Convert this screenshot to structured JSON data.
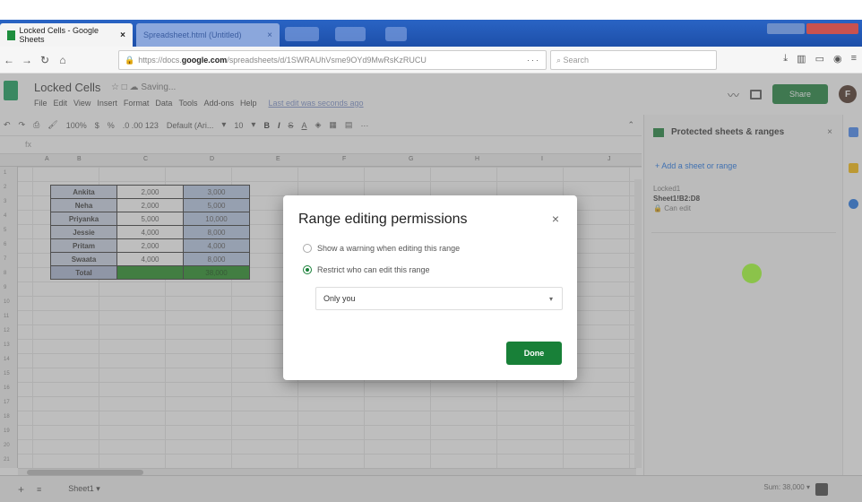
{
  "browser": {
    "tabs": [
      {
        "label": "Locked Cells - Google Sheets",
        "active": true
      },
      {
        "label": "Spreadsheet.html (Untitled)",
        "active": false
      }
    ],
    "url_prefix": "https://docs.",
    "url_domain": "google.com",
    "url_rest": "/spreadsheets/d/1SWRAUhVsme9OYd9MwRsKzRUCU",
    "url_tail": "···",
    "search_placeholder": "Search"
  },
  "sheets": {
    "title": "Locked Cells",
    "title_icons": "☆  □  ☁ Saving...",
    "menu": [
      "File",
      "Edit",
      "View",
      "Insert",
      "Format",
      "Data",
      "Tools",
      "Add-ons",
      "Help"
    ],
    "last_edit": "Last edit was seconds ago",
    "share_label": "Share",
    "avatar_letter": "F"
  },
  "toolbar": {
    "zoom": "100%",
    "currency": "$",
    "percent": "%",
    "decimals": ".0  .00  123",
    "font": "Default (Ari...",
    "font_size": "10",
    "bold": "B",
    "italic": "I",
    "strike": "S",
    "text_color": "A",
    "more": "···"
  },
  "formula": {
    "cell_ref": "",
    "fx": "fx"
  },
  "columns": [
    "A",
    "B",
    "C",
    "D",
    "E",
    "F",
    "G",
    "H",
    "I",
    "J"
  ],
  "rows": [
    "1",
    "2",
    "3",
    "4",
    "5",
    "6",
    "7",
    "8",
    "9",
    "10",
    "11",
    "12",
    "13",
    "14",
    "15",
    "16",
    "17",
    "18",
    "19",
    "20",
    "21"
  ],
  "table": {
    "rows": [
      {
        "name": "Ankita",
        "v1": "2,000",
        "v2": "3,000"
      },
      {
        "name": "Neha",
        "v1": "2,000",
        "v2": "5,000"
      },
      {
        "name": "Priyanka",
        "v1": "5,000",
        "v2": "10,000"
      },
      {
        "name": "Jessie",
        "v1": "4,000",
        "v2": "8,000"
      },
      {
        "name": "Pritam",
        "v1": "2,000",
        "v2": "4,000"
      },
      {
        "name": "Swaata",
        "v1": "4,000",
        "v2": "8,000"
      }
    ],
    "total_label": "Total",
    "total_v1": "",
    "total_v2": "38,000"
  },
  "side_panel": {
    "title": "Protected sheets & ranges",
    "close": "×",
    "add_label": "+ Add a sheet or range",
    "item": {
      "name": "Locked1",
      "range": "Sheet1!B2:D8",
      "perm": "Can edit"
    }
  },
  "modal": {
    "title": "Range editing permissions",
    "close": "×",
    "option_warning": "Show a warning when editing this range",
    "option_restrict": "Restrict who can edit this range",
    "selected_option": "restrict",
    "select_value": "Only you",
    "done_label": "Done"
  },
  "bottom": {
    "add": "+",
    "list": "≡",
    "sheet_tab": "Sheet1 ▾",
    "sum": "Sum: 38,000 ▾"
  },
  "colors": {
    "accent_green": "#188038",
    "total_fill": "#1e8a1e",
    "tab_bar": "#1d4fa9"
  }
}
